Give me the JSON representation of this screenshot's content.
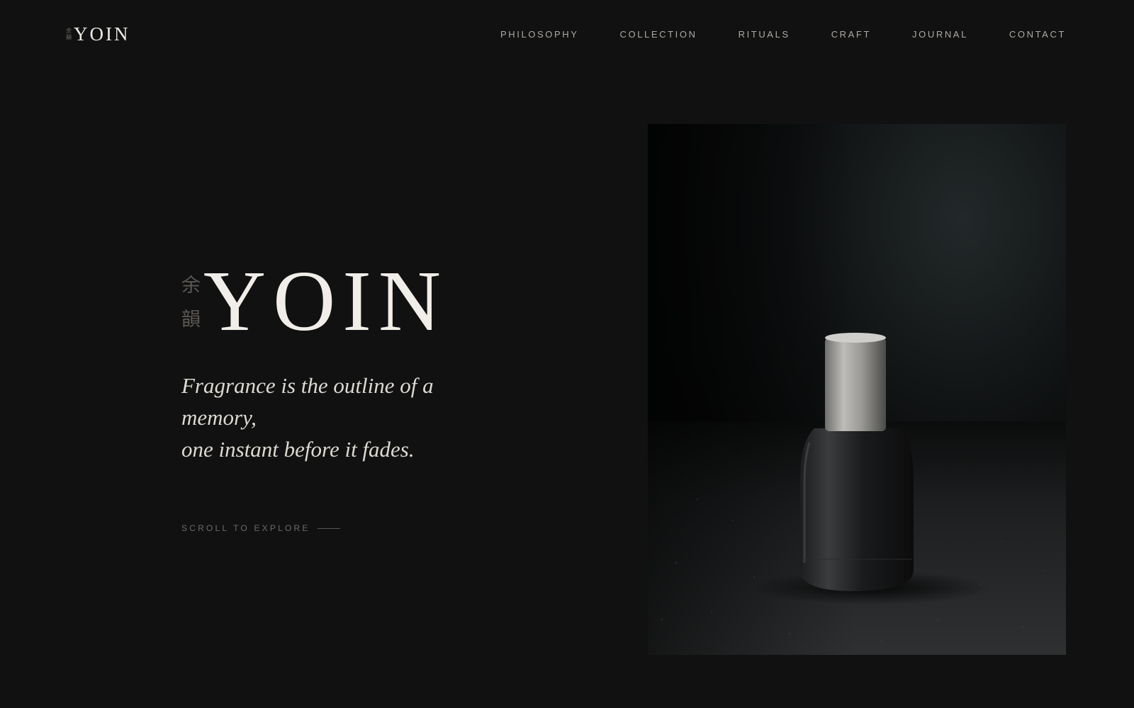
{
  "header": {
    "logo": {
      "kanji_top": "余",
      "kanji_bottom": "韻",
      "word": "YOIN"
    },
    "nav": [
      {
        "label": "PHILOSOPHY"
      },
      {
        "label": "COLLECTION"
      },
      {
        "label": "RITUALS"
      },
      {
        "label": "CRAFT"
      },
      {
        "label": "JOURNAL"
      },
      {
        "label": "CONTACT"
      }
    ]
  },
  "hero": {
    "kanji_top": "余",
    "kanji_bottom": "韻",
    "title": "YOIN",
    "tagline": {
      "line1": "Fragrance is the outline of a",
      "line2": "memory,",
      "line3": "one instant before it fades."
    },
    "scroll_label": "SCROLL TO EXPLORE"
  },
  "colors": {
    "background": "#111111",
    "text_primary": "#f1eee9",
    "text_muted": "#aeaaa4",
    "kanji": "#5b5855"
  }
}
